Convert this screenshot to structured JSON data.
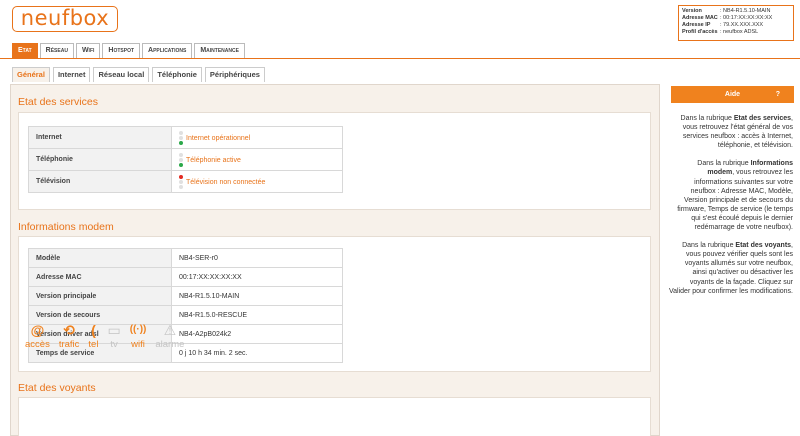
{
  "header": {
    "logo": "neufbox",
    "info": [
      {
        "key": "Version",
        "value": ": NB4-R1.5.10-MAIN"
      },
      {
        "key": "Adresse MAC",
        "value": ": 00:17:XX:XX:XX:XX"
      },
      {
        "key": "Adresse IP",
        "value": ": 79.XX.XXX.XXX"
      },
      {
        "key": "Profil d'accès",
        "value": ": neufbox ADSL"
      }
    ]
  },
  "main_nav": [
    "Etat",
    "Réseau",
    "Wifi",
    "Hotspot",
    "Applications",
    "Maintenance"
  ],
  "sub_nav": [
    "Général",
    "Internet",
    "Réseau local",
    "Téléphonie",
    "Périphériques"
  ],
  "services": {
    "title": "Etat des services",
    "rows": [
      {
        "label": "Internet",
        "status": "Internet opérationnel"
      },
      {
        "label": "Téléphonie",
        "status": "Téléphonie active"
      },
      {
        "label": "Télévision",
        "status": "Télévision non connectée"
      }
    ]
  },
  "modem": {
    "title": "Informations modem",
    "rows": [
      {
        "label": "Modèle",
        "value": "NB4-SER-r0"
      },
      {
        "label": "Adresse MAC",
        "value": "00:17:XX:XX:XX:XX"
      },
      {
        "label": "Version principale",
        "value": "NB4-R1.5.10-MAIN"
      },
      {
        "label": "Version de secours",
        "value": "NB4-R1.5.0-RESCUE"
      },
      {
        "label": "Version driver adsl",
        "value": "NB4-A2pB024k2"
      },
      {
        "label": "Temps de service",
        "value": "0 j 10 h 34 min. 2 sec."
      }
    ]
  },
  "voyants": {
    "title": "Etat des voyants",
    "items": [
      {
        "label": "accès",
        "icon": "at-icon",
        "glyph": "@",
        "state": "on"
      },
      {
        "label": "trafic",
        "icon": "traffic-icon",
        "glyph": "⟲",
        "state": "on"
      },
      {
        "label": "tel",
        "icon": "phone-icon",
        "glyph": "(",
        "state": "on"
      },
      {
        "label": "tv",
        "icon": "tv-icon",
        "glyph": "▭",
        "state": "off"
      },
      {
        "label": "wifi",
        "icon": "wifi-icon",
        "glyph": "((·))",
        "state": "on"
      },
      {
        "label": "alarme",
        "icon": "alarm-icon",
        "glyph": "⚠",
        "state": "off"
      }
    ]
  },
  "aide": {
    "title": "Aide",
    "q": "?",
    "p1_a": "Dans la rubrique ",
    "p1_b": "Etat des services",
    "p1_c": ", vous retrouvez l'état général de vos services neufbox : accès à Internet, téléphonie, et télévision.",
    "p2_a": "Dans la rubrique ",
    "p2_b": "Informations modem",
    "p2_c": ", vous retrouvez les informations suivantes sur votre neufbox : Adresse MAC, Modèle, Version principale et de secours du firmware, Temps de service (le temps qui s'est écoulé depuis le dernier redémarrage de votre neufbox).",
    "p3_a": "Dans la rubrique ",
    "p3_b": "Etat des voyants",
    "p3_c": ", vous pouvez vérifier quels sont les voyants allumés sur votre neufbox, ainsi qu'activer ou désactiver les voyants de la façade. Cliquez sur Valider pour confirmer les modifications."
  },
  "colors": {
    "accent": "#e8731a",
    "led_on": "#2ba84a",
    "led_off": "#e22b22"
  }
}
